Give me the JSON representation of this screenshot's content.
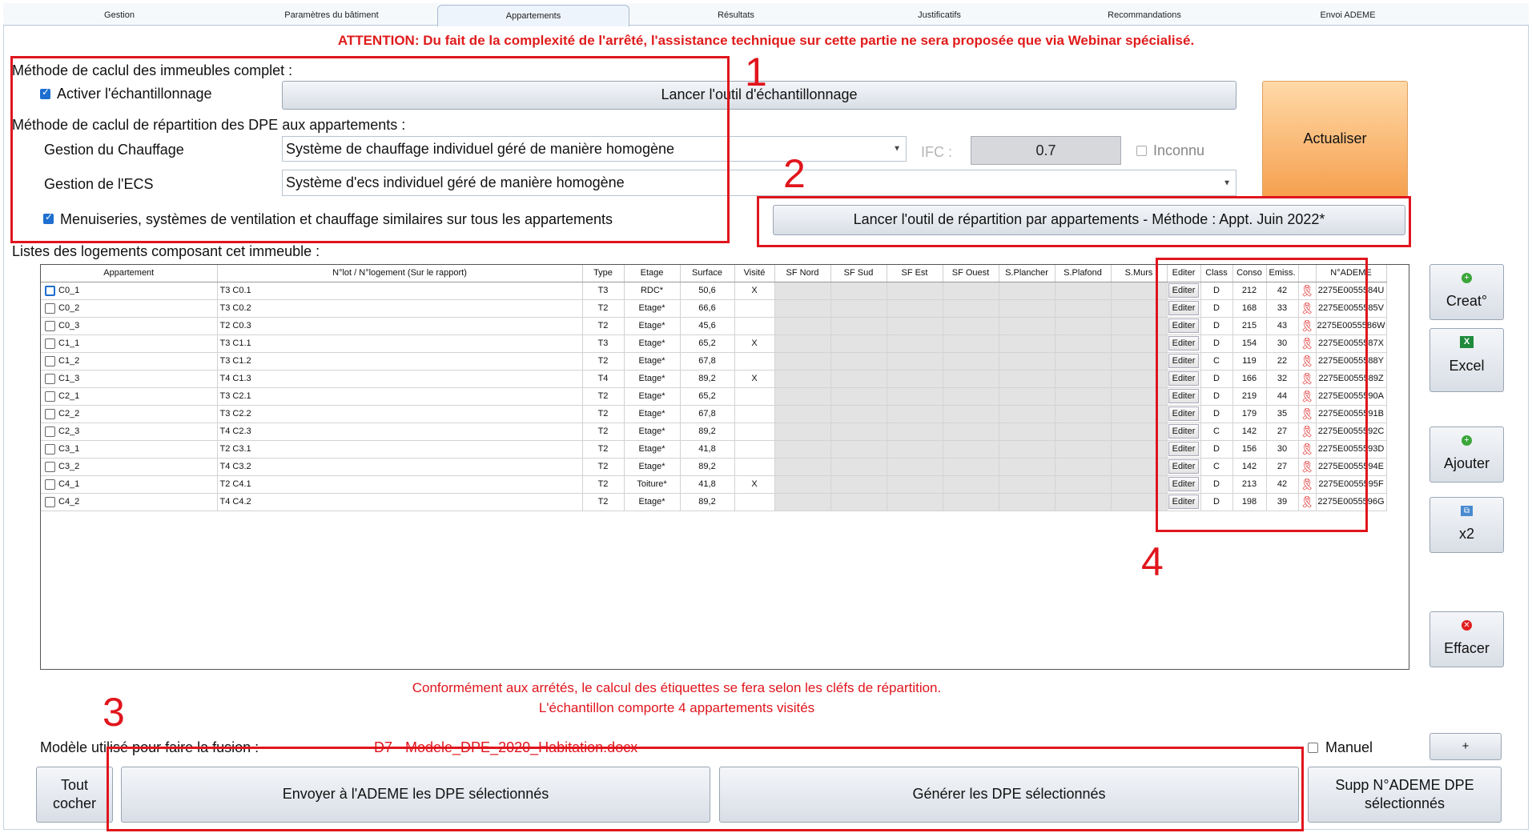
{
  "tabs": [
    "Gestion",
    "Paramètres du bâtiment",
    "Appartements",
    "Résultats",
    "Justificatifs",
    "Recommandations",
    "Envoi ADEME"
  ],
  "active_tab": "Appartements",
  "attention": "ATTENTION: Du fait de la complexité de l'arrêté, l'assistance technique sur cette partie ne sera proposée que via Webinar spécialisé.",
  "methode_complet_label": "Méthode de caclul des immeubles complet :",
  "activer_echantillonnage": "Activer l'échantillonnage",
  "lancer_echantillonnage": "Lancer l'outil d'échantillonnage",
  "actualiser": "Actualiser",
  "methode_repartition_label": "Méthode de caclul de répartition des DPE aux appartements :",
  "chauffage_label": "Gestion du Chauffage",
  "chauffage_value": "Système de chauffage individuel géré de manière homogène",
  "ecs_label": "Gestion de l'ECS",
  "ecs_value": "Système d'ecs individuel géré de manière homogène",
  "ifc_label": "IFC :",
  "ifc_value": "0.7",
  "inconnu_label": "Inconnu",
  "menuiseries_label": "Menuiseries, systèmes de ventilation et chauffage similaires sur tous les appartements",
  "lancer_repartition": "Lancer l'outil de répartition par appartements - Méthode : Appt. Juin 2022*",
  "listes_label": "Listes des logements composant cet immeuble :",
  "table": {
    "headers": [
      "Appartement",
      "N°lot / N°logement (Sur le rapport)",
      "Type",
      "Etage",
      "Surface",
      "Visité",
      "SF Nord",
      "SF Sud",
      "SF Est",
      "SF Ouest",
      "S.Plancher",
      "S.Plafond",
      "S.Murs",
      "Editer",
      "Class",
      "Conso",
      "Emiss.",
      "",
      "N°ADEME"
    ],
    "edit_label": "Editer",
    "rows": [
      {
        "appt": "C0_1",
        "lot": "T3 C0.1",
        "type": "T3",
        "etage": "RDC*",
        "surface": "50,6",
        "visite": "X",
        "class": "D",
        "conso": "212",
        "emiss": "42",
        "ademe": "2275E0055584U"
      },
      {
        "appt": "C0_2",
        "lot": "T3 C0.2",
        "type": "T2",
        "etage": "Etage*",
        "surface": "66,6",
        "visite": "",
        "class": "D",
        "conso": "168",
        "emiss": "33",
        "ademe": "2275E0055585V"
      },
      {
        "appt": "C0_3",
        "lot": "T2 C0.3",
        "type": "T2",
        "etage": "Etage*",
        "surface": "45,6",
        "visite": "",
        "class": "D",
        "conso": "215",
        "emiss": "43",
        "ademe": "2275E0055586W"
      },
      {
        "appt": "C1_1",
        "lot": "T3 C1.1",
        "type": "T3",
        "etage": "Etage*",
        "surface": "65,2",
        "visite": "X",
        "class": "D",
        "conso": "154",
        "emiss": "30",
        "ademe": "2275E0055587X"
      },
      {
        "appt": "C1_2",
        "lot": "T3 C1.2",
        "type": "T2",
        "etage": "Etage*",
        "surface": "67,8",
        "visite": "",
        "class": "C",
        "conso": "119",
        "emiss": "22",
        "ademe": "2275E0055588Y"
      },
      {
        "appt": "C1_3",
        "lot": "T4 C1.3",
        "type": "T4",
        "etage": "Etage*",
        "surface": "89,2",
        "visite": "X",
        "class": "D",
        "conso": "166",
        "emiss": "32",
        "ademe": "2275E0055589Z"
      },
      {
        "appt": "C2_1",
        "lot": "T3 C2.1",
        "type": "T2",
        "etage": "Etage*",
        "surface": "65,2",
        "visite": "",
        "class": "D",
        "conso": "219",
        "emiss": "44",
        "ademe": "2275E0055590A"
      },
      {
        "appt": "C2_2",
        "lot": "T3 C2.2",
        "type": "T2",
        "etage": "Etage*",
        "surface": "67,8",
        "visite": "",
        "class": "D",
        "conso": "179",
        "emiss": "35",
        "ademe": "2275E0055591B"
      },
      {
        "appt": "C2_3",
        "lot": "T4 C2.3",
        "type": "T2",
        "etage": "Etage*",
        "surface": "89,2",
        "visite": "",
        "class": "C",
        "conso": "142",
        "emiss": "27",
        "ademe": "2275E0055592C"
      },
      {
        "appt": "C3_1",
        "lot": "T2 C3.1",
        "type": "T2",
        "etage": "Etage*",
        "surface": "41,8",
        "visite": "",
        "class": "D",
        "conso": "156",
        "emiss": "30",
        "ademe": "2275E0055593D"
      },
      {
        "appt": "C3_2",
        "lot": "T4 C3.2",
        "type": "T2",
        "etage": "Etage*",
        "surface": "89,2",
        "visite": "",
        "class": "C",
        "conso": "142",
        "emiss": "27",
        "ademe": "2275E0055594E"
      },
      {
        "appt": "C4_1",
        "lot": "T2 C4.1",
        "type": "T2",
        "etage": "Toiture*",
        "surface": "41,8",
        "visite": "X",
        "class": "D",
        "conso": "213",
        "emiss": "42",
        "ademe": "2275E0055595F"
      },
      {
        "appt": "C4_2",
        "lot": "T4 C4.2",
        "type": "T2",
        "etage": "Etage*",
        "surface": "89,2",
        "visite": "",
        "class": "D",
        "conso": "198",
        "emiss": "39",
        "ademe": "2275E0055596G"
      }
    ]
  },
  "side_buttons": {
    "creat": "Creat°",
    "excel": "Excel",
    "ajouter": "Ajouter",
    "x2": "x2",
    "effacer": "Effacer"
  },
  "info_line1": "Conformément aux arrétés, le calcul des étiquettes se fera selon les cléfs de répartition.",
  "info_line2": "L'échantillon comporte 4 appartements visités",
  "modele_label": "Modèle utilisé pour faire la fusion :",
  "modele_file": "D7 - Modele_DPE_2020_Habitation.docx",
  "manuel_label": "Manuel",
  "plus_label": "+",
  "tout_cocher": "Tout cocher",
  "envoyer": "Envoyer à l'ADEME les DPE sélectionnés",
  "generer": "Générer les DPE sélectionnés",
  "supp": "Supp N°ADEME DPE sélectionnés",
  "annotations": [
    "1",
    "2",
    "3",
    "4"
  ],
  "colors": {
    "annotation_red": "#e0151d",
    "attention_red": "#e01b1b",
    "actualiser_orange": "#f5a04e",
    "checkbox_blue": "#1e6fd0"
  }
}
